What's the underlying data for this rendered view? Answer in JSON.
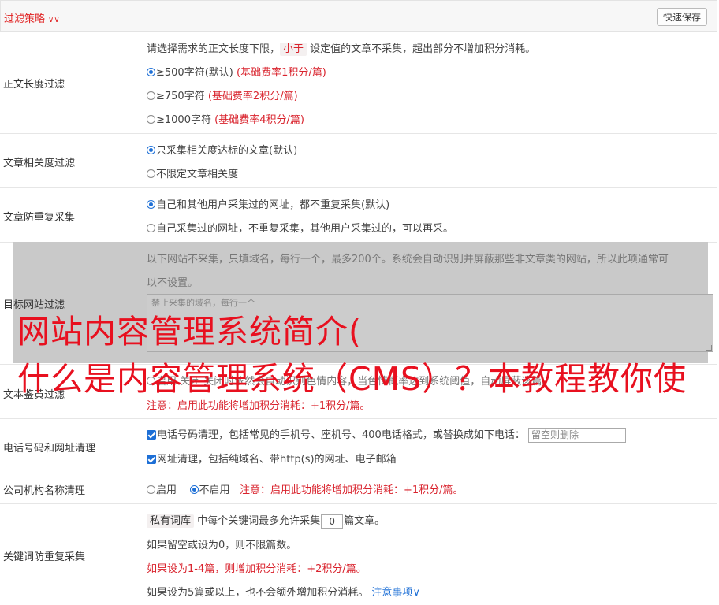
{
  "header": {
    "title": "过滤策略",
    "save_button": "快速保存"
  },
  "length_filter": {
    "label": "正文长度过滤",
    "desc_pre": "请选择需求的正文长度下限，",
    "desc_tag": "小于",
    "desc_post": "设定值的文章不采集，超出部分不增加积分消耗。",
    "options": [
      {
        "text": "≥500字符(默认)",
        "cost": "(基础费率1积分/篇)",
        "selected": true
      },
      {
        "text": "≥750字符",
        "cost": "(基础费率2积分/篇)",
        "selected": false
      },
      {
        "text": "≥1000字符",
        "cost": "(基础费率4积分/篇)",
        "selected": false
      }
    ]
  },
  "relevance": {
    "label": "文章相关度过滤",
    "options": [
      "只采集相关度达标的文章(默认)",
      "不限定文章相关度"
    ]
  },
  "dedupe": {
    "label": "文章防重复采集",
    "options": [
      "自己和其他用户采集过的网址，都不重复采集(默认)",
      "自己采集过的网址，不重复采集，其他用户采集过的，可以再采。"
    ]
  },
  "target_site": {
    "label": "目标网站过滤",
    "desc_line1": "以下网站不采集，只填域名，每行一个，最多200个。系统会自动识别并屏蔽那些非文章类的网站，所以此项通常可",
    "desc_line2": "以不设置。",
    "placeholder": "禁止采集的域名，每行一个"
  },
  "porn_filter": {
    "label": "文本鉴黄过滤",
    "line1": "启用  关闭  关闭时依然会自动识别色情内容，当色情概率达到系统阈值，自动屏蔽该篇。",
    "note": "注意：启用此功能将增加积分消耗：+1积分/篇。"
  },
  "phone_url": {
    "label": "电话号码和网址清理",
    "phone_text": "电话号码清理，包括常见的手机号、座机号、400电话格式，或替换成如下电话：",
    "phone_placeholder": "留空则删除",
    "url_text": "网址清理，包括纯域名、带http(s)的网址、电子邮箱"
  },
  "company": {
    "label": "公司机构名称清理",
    "enable": "启用",
    "disable": "不启用",
    "note": "注意：启用此功能将增加积分消耗：+1积分/篇。"
  },
  "keyword": {
    "label": "关键词防重复采集",
    "tag": "私有词库",
    "text_pre": "中每个关键词最多允许采集",
    "value": "0",
    "text_post": "篇文章。",
    "line2": "如果留空或设为0，则不限篇数。",
    "line3": "如果设为1-4篇，则增加积分消耗：+2积分/篇。",
    "line4": "如果设为5篇或以上，也不会额外增加积分消耗。",
    "notice_link": "注意事项"
  },
  "overlay": {
    "line1": "网站内容管理系统简介(",
    "line2": "什么是内容管理系统（CMS）？本教程教你使"
  }
}
